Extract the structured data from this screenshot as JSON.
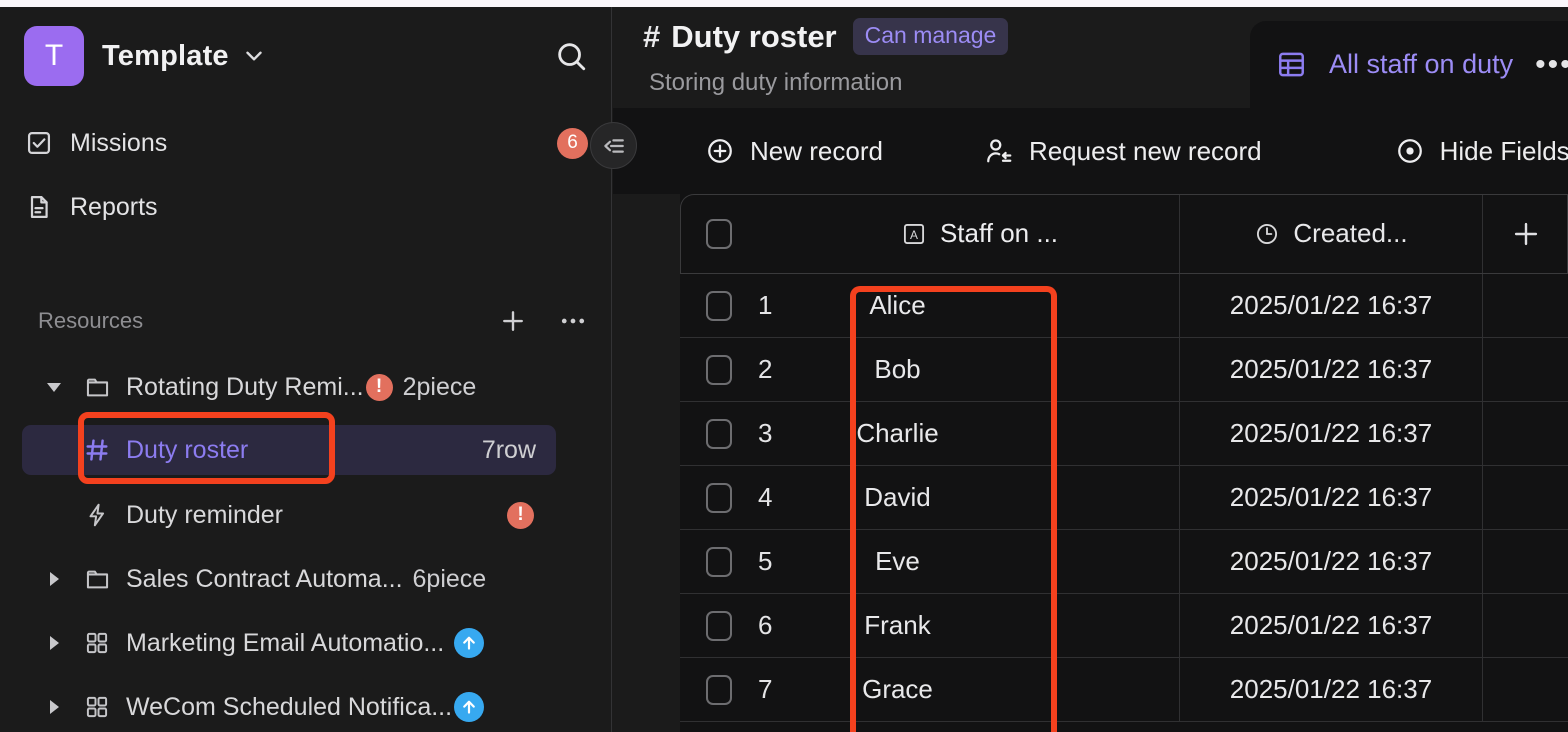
{
  "workspace": {
    "logo_letter": "T",
    "name": "Template",
    "caret_icon": "chevron-down-icon",
    "search_icon": "search-icon"
  },
  "sidebar": {
    "nav": [
      {
        "label": "Missions",
        "icon": "checkbox-task-icon",
        "badge": "6"
      },
      {
        "label": "Reports",
        "icon": "document-icon",
        "badge": ""
      }
    ],
    "section": {
      "title": "Resources",
      "add_icon": "plus-icon",
      "more_icon": "ellipsis-icon"
    },
    "tree": [
      {
        "label": "Rotating Duty Remi...",
        "icon": "folder-icon",
        "twisty": "triangle-down-icon",
        "warning": "!",
        "count": "2piece",
        "count_right": false,
        "selected": false,
        "accent": false,
        "upload": false
      },
      {
        "label": "Duty roster",
        "icon": "hash-table-icon",
        "twisty": "",
        "warning": "",
        "count": "7row",
        "count_right": true,
        "selected": true,
        "accent": true,
        "upload": false
      },
      {
        "label": "Duty reminder",
        "icon": "lightning-bolt-icon",
        "twisty": "",
        "warning": "!",
        "count": "",
        "count_right": true,
        "selected": false,
        "accent": false,
        "upload": false
      },
      {
        "label": "Sales Contract Automa...",
        "icon": "folder-icon",
        "twisty": "triangle-right-icon",
        "warning": "",
        "count": "6piece",
        "count_right": false,
        "selected": false,
        "accent": false,
        "upload": false
      },
      {
        "label": "Marketing Email Automatio...",
        "icon": "apps-grid-icon",
        "twisty": "triangle-right-icon",
        "warning": "",
        "count": "",
        "count_right": false,
        "selected": false,
        "accent": false,
        "upload": true
      },
      {
        "label": "WeCom Scheduled Notifica...",
        "icon": "apps-grid-icon",
        "twisty": "triangle-right-icon",
        "warning": "",
        "count": "",
        "count_right": false,
        "selected": false,
        "accent": false,
        "upload": true
      }
    ],
    "collapse_icon": "collapse-sidebar-icon"
  },
  "document": {
    "hash": "#",
    "title": "Duty roster",
    "permission_badge": "Can manage",
    "subtitle": "Storing duty information"
  },
  "view_tab": {
    "icon": "grid-table-icon",
    "label": "All staff on duty",
    "more": "•••"
  },
  "toolbar": {
    "new_record": {
      "label": "New record",
      "icon": "plus-circle-icon"
    },
    "request_new_record": {
      "label": "Request new record",
      "icon": "person-request-icon"
    },
    "hide_fields": {
      "label": "Hide Fields",
      "icon": "eye-icon"
    }
  },
  "table": {
    "columns": [
      {
        "key": "name",
        "label": "Staff on ...",
        "icon": "text-field-icon"
      },
      {
        "key": "created",
        "label": "Created...",
        "icon": "clock-icon"
      }
    ],
    "add_field_icon": "plus-icon",
    "rows": [
      {
        "num": "1",
        "name": "Alice",
        "created": "2025/01/22 16:37"
      },
      {
        "num": "2",
        "name": "Bob",
        "created": "2025/01/22 16:37"
      },
      {
        "num": "3",
        "name": "Charlie",
        "created": "2025/01/22 16:37"
      },
      {
        "num": "4",
        "name": "David",
        "created": "2025/01/22 16:37"
      },
      {
        "num": "5",
        "name": "Eve",
        "created": "2025/01/22 16:37"
      },
      {
        "num": "6",
        "name": "Frank",
        "created": "2025/01/22 16:37"
      },
      {
        "num": "7",
        "name": "Grace",
        "created": "2025/01/22 16:37"
      }
    ]
  },
  "annotations": {
    "highlight_color": "#f4411e",
    "boxes": [
      {
        "name": "sidebar-duty-roster-highlight"
      },
      {
        "name": "staff-name-column-highlight"
      }
    ]
  },
  "colors": {
    "accent_purple": "#8c7cf0",
    "logo_purple": "#9b6cf0",
    "badge_red": "#e2705e",
    "upload_blue": "#37a9f0",
    "app_bg": "#1b1b1b",
    "panel_bg": "#121213"
  }
}
